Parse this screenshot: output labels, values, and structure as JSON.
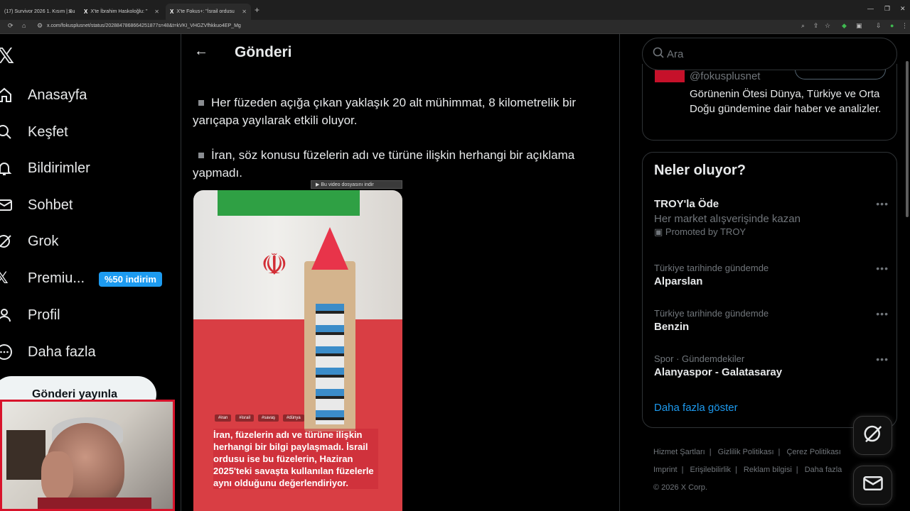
{
  "browser": {
    "tabs": [
      {
        "label": "(17) Survivor 2026 1. Kısım | Su"
      },
      {
        "label": "X'te İbrahim Haskoloğlu: \""
      },
      {
        "label": "X'te Fokus+: \"İsrail ordusu"
      }
    ],
    "url": "x.com/fokusplusnet/status/2028847868664251877s=48&t=kVKI_VHGZVfhkkuo4EP_Mg"
  },
  "nav": {
    "items": [
      {
        "label": "Anasayfa",
        "icon": "home-icon"
      },
      {
        "label": "Keşfet",
        "icon": "search-icon"
      },
      {
        "label": "Bildirimler",
        "icon": "bell-icon"
      },
      {
        "label": "Sohbet",
        "icon": "mail-icon"
      },
      {
        "label": "Grok",
        "icon": "grok-icon"
      },
      {
        "label": "Premiu...",
        "icon": "x-logo-icon"
      },
      {
        "label": "Profil",
        "icon": "person-icon"
      },
      {
        "label": "Daha fazla",
        "icon": "more-circle-icon"
      }
    ],
    "premium_badge": "%50 indirim",
    "post_button": "Gönderi yayınla"
  },
  "post": {
    "header_title": "Gönderi",
    "paragraphs": [
      "Her füzeden açığa çıkan yaklaşık 20 alt mühimmat, 8 kilometrelik bir yarıçapa yayılarak etkili oluyor.",
      "İran, söz konusu füzelerin adı ve türüne ilişkin herhangi bir açıklama yapmadı."
    ],
    "download_bar": "▶ Bu video dosyasını indir",
    "media_tags": [
      "#iran",
      "#israil",
      "#savaş",
      "#dünya"
    ],
    "media_caption": "İran, füzelerin adı ve türüne ilişkin herhangi bir bilgi paylaşmadı. İsrail ordusu ise bu füzelerin, Haziran 2025'teki savaşta kullanılan füzelerle aynı olduğunu değerlendiriyor."
  },
  "right": {
    "search_placeholder": "Ara",
    "account": {
      "handle": "@fokusplusnet",
      "bio": "Görünenin Ötesi Dünya, Türkiye ve Orta Doğu gündemine dair haber ve analizler."
    },
    "trends_title": "Neler oluyor?",
    "trends": [
      {
        "meta": "",
        "name": "TROY'la Öde",
        "sub": "Her market alışverişinde kazan",
        "promo": "Promoted by TROY"
      },
      {
        "meta": "Türkiye tarihinde gündemde",
        "name": "Alparslan"
      },
      {
        "meta": "Türkiye tarihinde gündemde",
        "name": "Benzin"
      },
      {
        "meta": "Spor · Gündemdekiler",
        "name": "Alanyaspor - Galatasaray"
      }
    ],
    "show_more": "Daha fazla göster",
    "footer_links": [
      "Hizmet Şartları",
      "Gizlilik Politikası",
      "Çerez Politikası",
      "Imprint",
      "Erişilebilirlik",
      "Reklam bilgisi",
      "Daha fazla"
    ],
    "copyright": "© 2026 X Corp."
  }
}
